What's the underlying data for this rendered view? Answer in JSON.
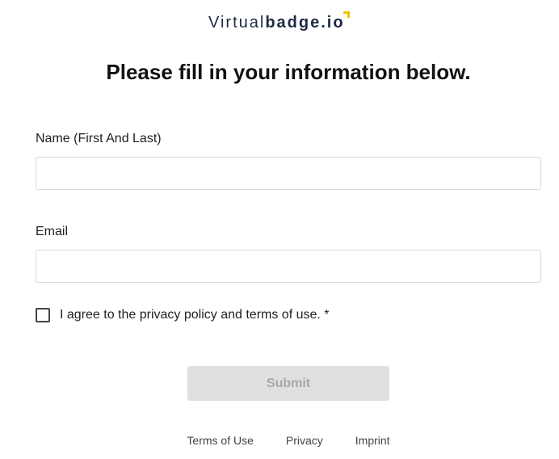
{
  "logo": {
    "light_text": "Virtual",
    "bold_text": "badge.io"
  },
  "heading": "Please fill in your information below.",
  "form": {
    "name": {
      "label": "Name (First And Last)",
      "value": "",
      "placeholder": ""
    },
    "email": {
      "label": "Email",
      "value": "",
      "placeholder": ""
    },
    "consent": {
      "label": "I agree to the privacy policy and terms of use. *",
      "checked": false
    },
    "submit_label": "Submit"
  },
  "footer": {
    "terms": "Terms of Use",
    "privacy": "Privacy",
    "imprint": "Imprint"
  },
  "colors": {
    "brand_dark": "#1d2a44",
    "brand_accent": "#f2c200",
    "submit_disabled_bg": "#e0e0e0",
    "submit_disabled_text": "#a8a8a8"
  }
}
